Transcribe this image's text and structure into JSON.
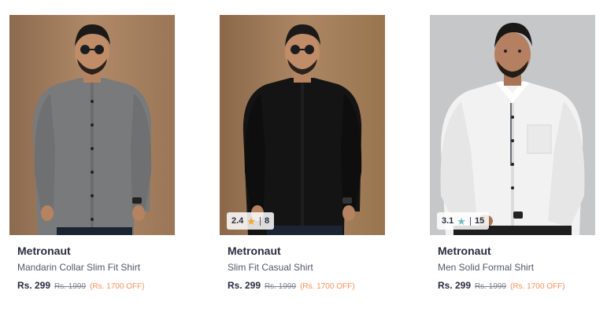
{
  "colors": {
    "brand_text": "#282c3f",
    "name_text": "#535766",
    "mrp_text": "#7e818c",
    "discount_text": "#ff905a",
    "rating_star_high": "#f5a623",
    "rating_star_mid": "#72bfbc"
  },
  "products": [
    {
      "brand": "Metronaut",
      "name": "Mandarin Collar Slim Fit Shirt",
      "price": "Rs. 299",
      "mrp": "Rs. 1999",
      "discount": "(Rs. 1700 OFF)",
      "shirt_color": "#7a7b7d",
      "background": "#a07a5a"
    },
    {
      "brand": "Metronaut",
      "name": "Slim Fit Casual Shirt",
      "price": "Rs. 299",
      "mrp": "Rs. 1999",
      "discount": "(Rs. 1700 OFF)",
      "rating": "2.4",
      "rating_count": "8",
      "star_icon": "star-icon",
      "shirt_color": "#141414",
      "background": "#9d7756"
    },
    {
      "brand": "Metronaut",
      "name": "Men Solid Formal Shirt",
      "price": "Rs. 299",
      "mrp": "Rs. 1999",
      "discount": "(Rs. 1700 OFF)",
      "rating": "3.1",
      "rating_count": "15",
      "star_icon": "star-icon",
      "shirt_color": "#f4f4f4",
      "background": "#c8c9cb"
    }
  ]
}
